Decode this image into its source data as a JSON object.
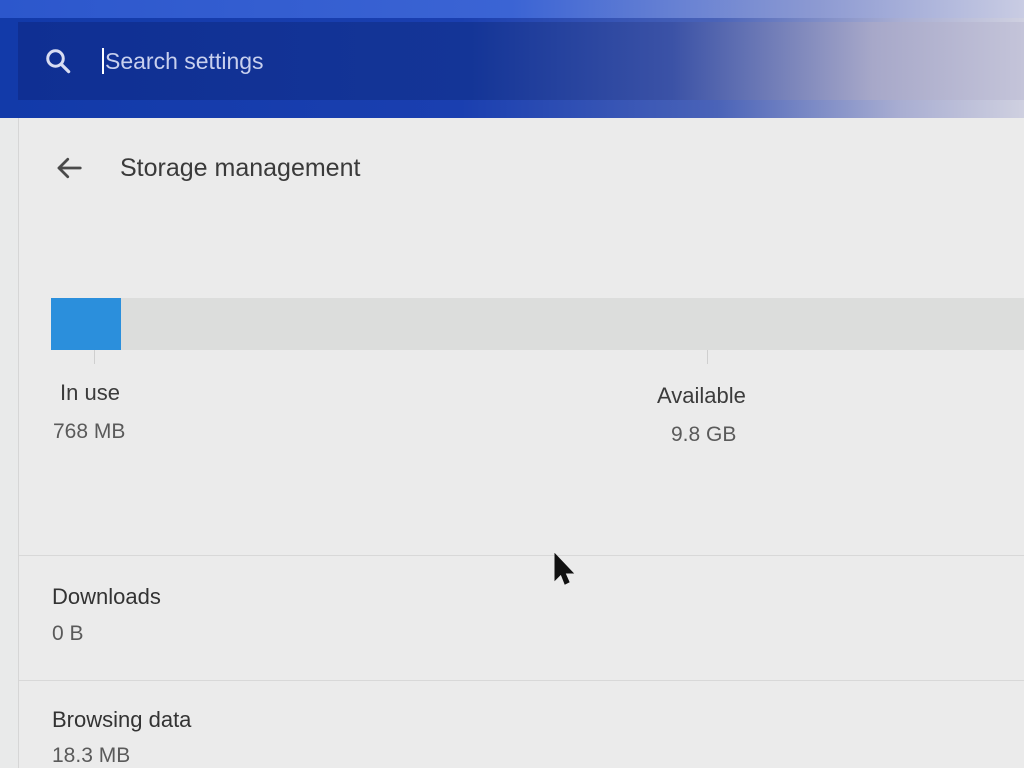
{
  "search": {
    "placeholder": "Search settings",
    "icon": "search-icon"
  },
  "header": {
    "title": "Storage management",
    "back_icon": "arrow-back-icon"
  },
  "storage": {
    "used_fraction": 0.072,
    "in_use_label": "In use",
    "in_use_value": "768 MB",
    "available_label": "Available",
    "available_value": "9.8 GB",
    "bar_color": "#2b8fdc"
  },
  "items": [
    {
      "label": "Downloads",
      "value": "0 B"
    },
    {
      "label": "Browsing data",
      "value": "18.3 MB"
    }
  ],
  "colors": {
    "header_blue": "#123aa9",
    "accent": "#2b8fdc",
    "background": "#ebebeb"
  }
}
